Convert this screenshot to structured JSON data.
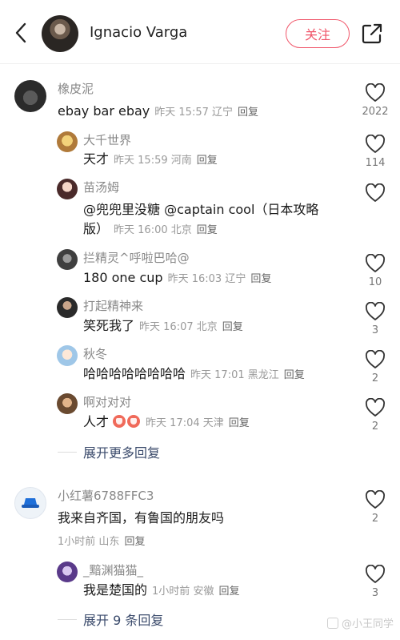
{
  "header": {
    "author_name": "Ignacio Varga",
    "follow_label": "关注"
  },
  "comments": [
    {
      "username": "橡皮泥",
      "text": "ebay bar ebay",
      "time": "昨天 15:57",
      "location": "辽宁",
      "reply_label": "回复",
      "likes": "2022"
    },
    {
      "username": "小红薯6788FFC3",
      "text": "我来自齐国，有鲁国的朋友吗",
      "time": "1小时前",
      "location": "山东",
      "reply_label": "回复",
      "likes": "2"
    }
  ],
  "replies": [
    {
      "username": "大千世界",
      "text": "天才",
      "time": "昨天 15:59",
      "location": "河南",
      "reply_label": "回复",
      "likes": "114"
    },
    {
      "username": "苗汤姆",
      "text_line1": "@兜兜里没糖  @captain cool（日本攻略",
      "text_line2": "版）",
      "time": "昨天 16:00",
      "location": "北京",
      "reply_label": "回复",
      "likes": ""
    },
    {
      "username": "拦精灵^呼啦巴哈@",
      "text": "180 one cup",
      "time": "昨天 16:03",
      "location": "辽宁",
      "reply_label": "回复",
      "likes": "10"
    },
    {
      "username": "打起精神来",
      "text": "笑死我了",
      "time": "昨天 16:07",
      "location": "北京",
      "reply_label": "回复",
      "likes": "3"
    },
    {
      "username": "秋冬",
      "text": "哈哈哈哈哈哈哈哈",
      "time": "昨天 17:01",
      "location": "黑龙江",
      "reply_label": "回复",
      "likes": "2"
    },
    {
      "username": "啊对对对",
      "text": "人才",
      "time": "昨天 17:04",
      "location": "天津",
      "reply_label": "回复",
      "likes": "2"
    },
    {
      "username": "_黯渊猫猫_",
      "text": "我是楚国的",
      "time": "1小时前",
      "location": "安徽",
      "reply_label": "回复",
      "likes": "3"
    }
  ],
  "expand_more_1": "展开更多回复",
  "expand_more_2": "展开 9 条回复",
  "watermark": "@小王同学",
  "colors": {
    "accent": "#f0566a",
    "link": "#3a4a6b"
  }
}
